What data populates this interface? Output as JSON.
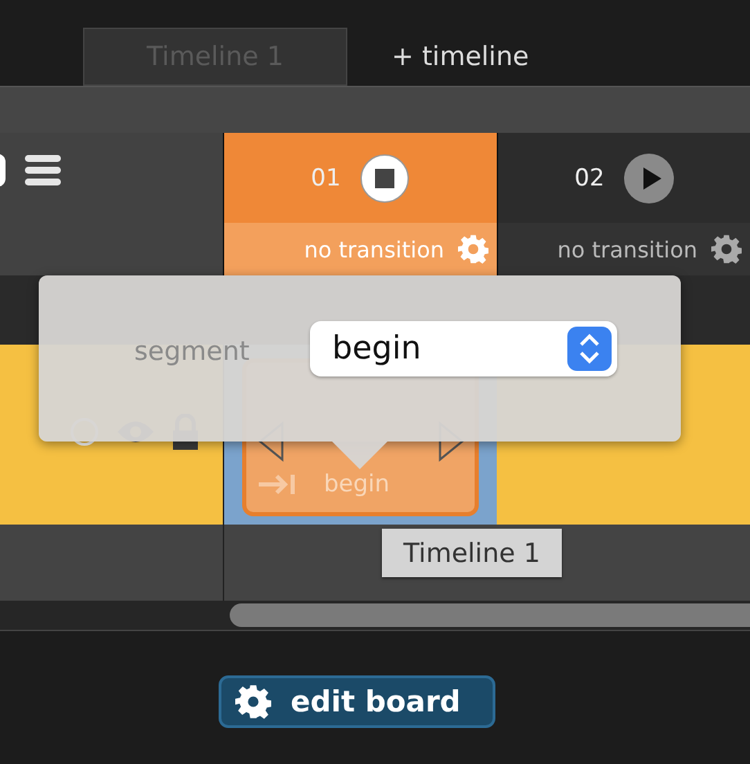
{
  "tabs": [
    {
      "label": "Timeline 1",
      "selected": true
    },
    {
      "label": "+ timeline",
      "selected": false
    }
  ],
  "columns": [
    {
      "number": "01",
      "playing": true,
      "transition": "no transition"
    },
    {
      "number": "02",
      "playing": false,
      "transition": "no transition"
    }
  ],
  "clip": {
    "label": "begin"
  },
  "popover": {
    "label": "segment",
    "value": "begin"
  },
  "tooltip": "Timeline 1",
  "edit_button": "edit board"
}
